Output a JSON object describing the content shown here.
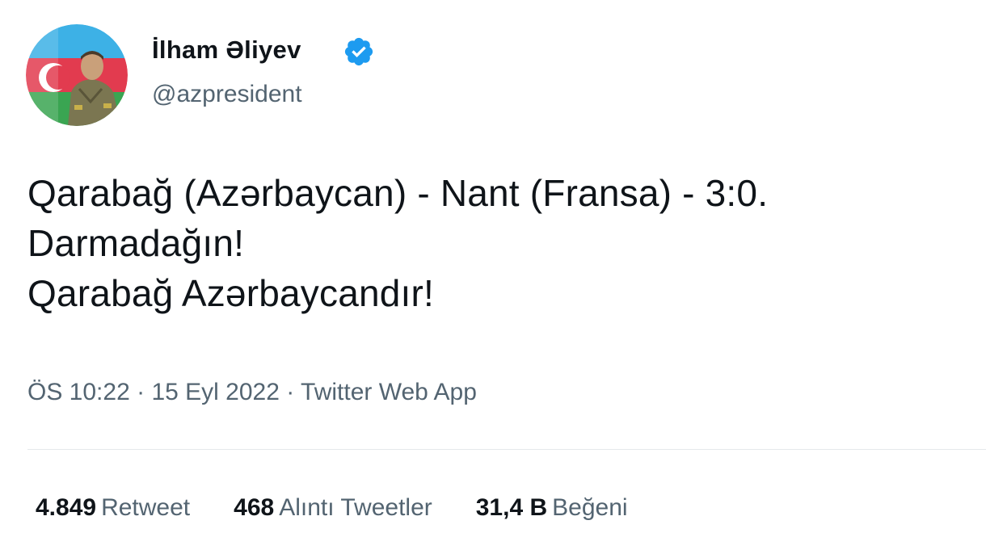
{
  "author": {
    "display_name": "İlham Əliyev",
    "handle": "@azpresident",
    "verified_icon": "verified-badge-icon",
    "avatar": "avatar-photo"
  },
  "tweet": {
    "lines": [
      "Qarabağ (Azərbaycan) - Nant (Fransa) - 3:0.",
      "Darmadağın!",
      "Qarabağ Azərbaycandır!"
    ]
  },
  "meta": {
    "time": "ÖS 10:22",
    "separator": "·",
    "date": "15 Eyl 2022",
    "source": "Twitter Web App"
  },
  "stats": {
    "retweets": {
      "count": "4.849",
      "label": "Retweet"
    },
    "quotes": {
      "count": "468",
      "label": "Alıntı Tweetler"
    },
    "likes": {
      "count": "31,4 B",
      "label": "Beğeni"
    }
  },
  "colors": {
    "text": "#0f1419",
    "secondary": "#536471",
    "verified": "#1d9bf0",
    "divider": "#e5e8eb"
  }
}
